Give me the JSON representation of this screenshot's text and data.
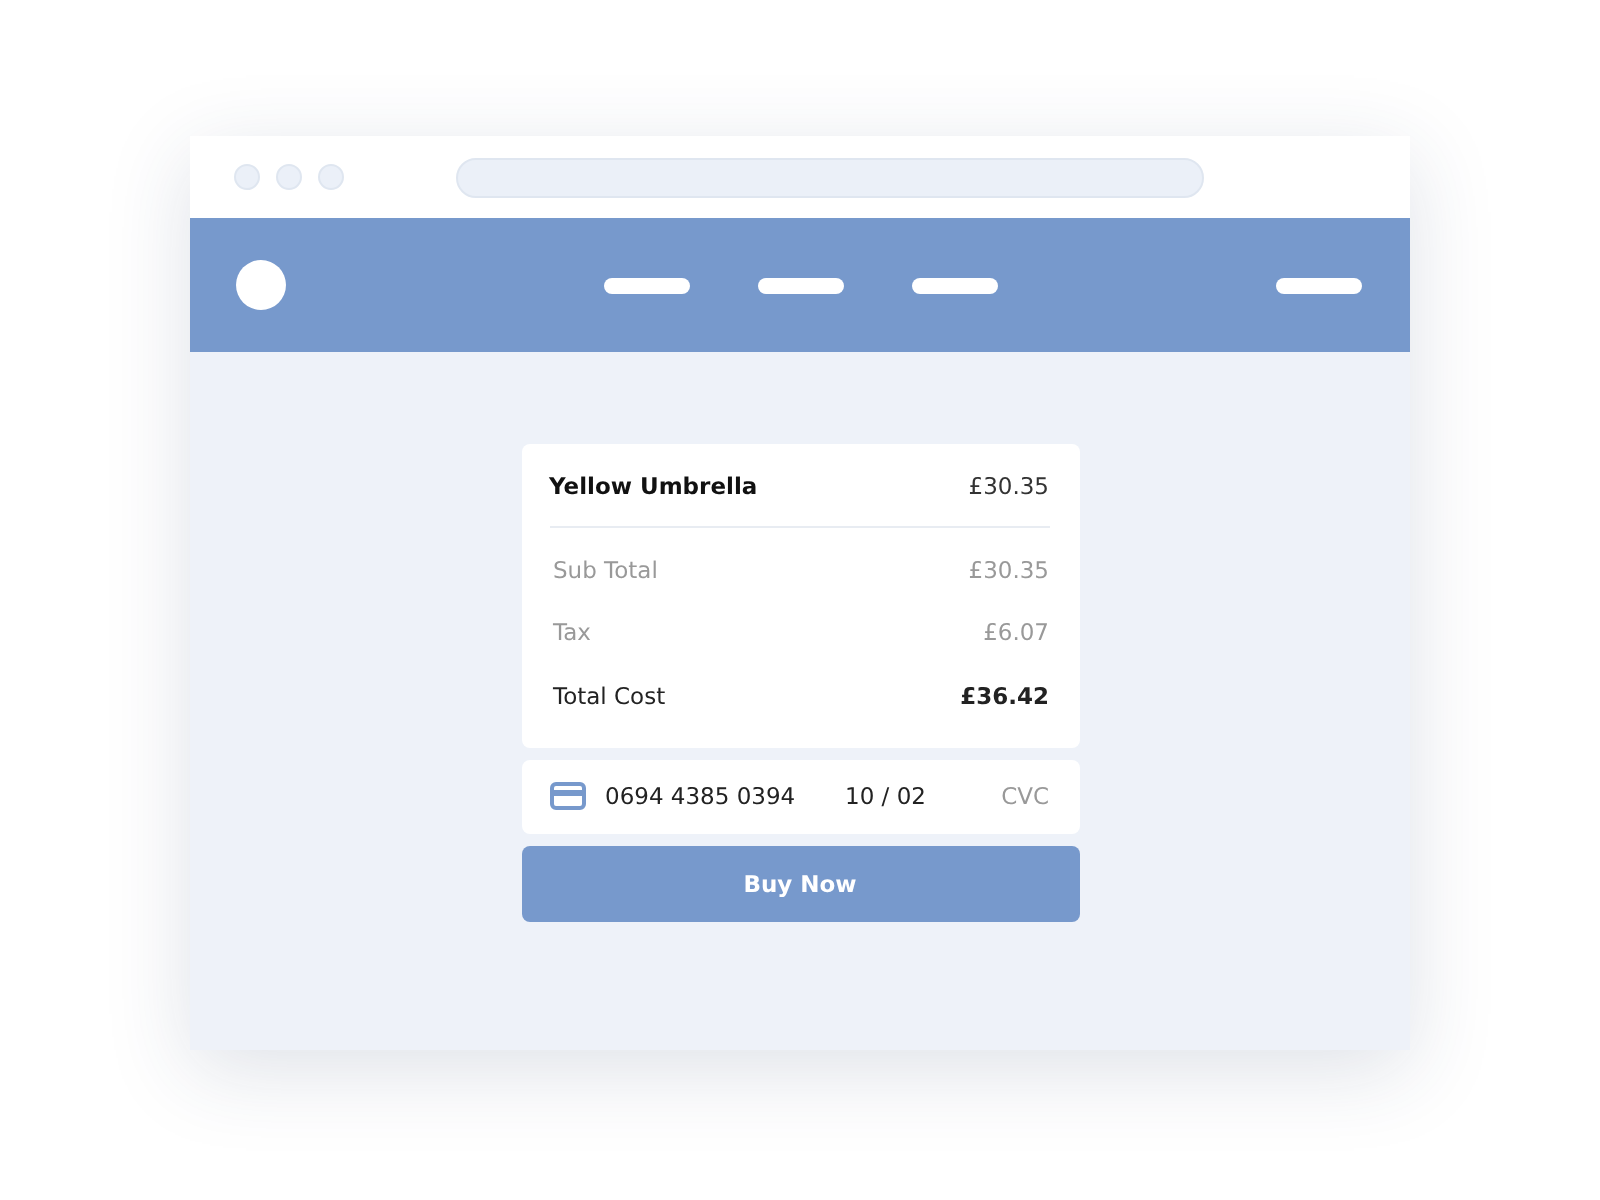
{
  "product": {
    "name": "Yellow Umbrella",
    "price": "£30.35"
  },
  "summary": [
    {
      "label": "Sub Total",
      "amount": "£30.35",
      "kind": "line"
    },
    {
      "label": "Tax",
      "amount": "£6.07",
      "kind": "line"
    },
    {
      "label": "Total Cost",
      "amount": "£36.42",
      "kind": "total"
    }
  ],
  "payment": {
    "card_number": "0694 4385 0394",
    "expiry": "10 / 02",
    "cvc": {
      "placeholder": "CVC"
    }
  },
  "buttons": [
    "Buy Now"
  ]
}
